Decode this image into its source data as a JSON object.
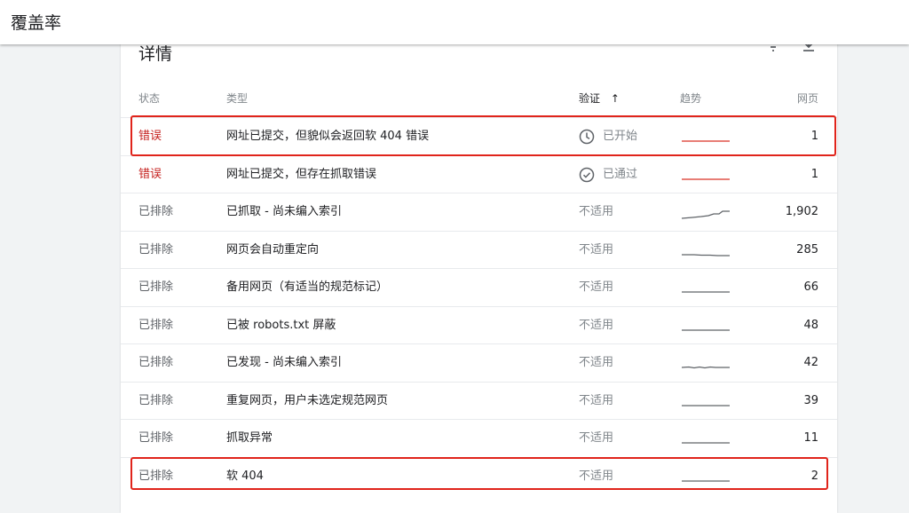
{
  "header": {
    "title": "覆盖率"
  },
  "card": {
    "title": "详情"
  },
  "columns": {
    "status": "状态",
    "type": "类型",
    "verify": "验证",
    "verify_sort": "↑",
    "trend": "趋势",
    "pages": "网页"
  },
  "colors": {
    "error": "#c5221f",
    "highlight": "#e0241b",
    "trend_error": "#d93025",
    "trend_excluded": "#5f6368"
  },
  "rows": [
    {
      "status": "错误",
      "kind": "error",
      "type": "网址已提交，但貌似会返回软 404 错误",
      "verify": "已开始",
      "verify_icon": "clock-icon",
      "pages": "1",
      "trend": "flat-error"
    },
    {
      "status": "错误",
      "kind": "error",
      "type": "网址已提交，但存在抓取错误",
      "verify": "已通过",
      "verify_icon": "check-circle-icon",
      "pages": "1",
      "trend": "flat-error"
    },
    {
      "status": "已排除",
      "kind": "excluded",
      "type": "已抓取 - 尚未编入索引",
      "verify": "不适用",
      "verify_icon": "",
      "pages": "1,902",
      "trend": "rising"
    },
    {
      "status": "已排除",
      "kind": "excluded",
      "type": "网页会自动重定向",
      "verify": "不适用",
      "verify_icon": "",
      "pages": "285",
      "trend": "slight-dip"
    },
    {
      "status": "已排除",
      "kind": "excluded",
      "type": "备用网页（有适当的规范标记）",
      "verify": "不适用",
      "verify_icon": "",
      "pages": "66",
      "trend": "flat"
    },
    {
      "status": "已排除",
      "kind": "excluded",
      "type": "已被 robots.txt 屏蔽",
      "verify": "不适用",
      "verify_icon": "",
      "pages": "48",
      "trend": "flat"
    },
    {
      "status": "已排除",
      "kind": "excluded",
      "type": "已发现 - 尚未编入索引",
      "verify": "不适用",
      "verify_icon": "",
      "pages": "42",
      "trend": "wiggle"
    },
    {
      "status": "已排除",
      "kind": "excluded",
      "type": "重复网页，用户未选定规范网页",
      "verify": "不适用",
      "verify_icon": "",
      "pages": "39",
      "trend": "flat"
    },
    {
      "status": "已排除",
      "kind": "excluded",
      "type": "抓取异常",
      "verify": "不适用",
      "verify_icon": "",
      "pages": "11",
      "trend": "flat"
    },
    {
      "status": "已排除",
      "kind": "excluded",
      "type": "软 404",
      "verify": "不适用",
      "verify_icon": "",
      "pages": "2",
      "trend": "flat"
    }
  ],
  "highlights": [
    0,
    9
  ]
}
